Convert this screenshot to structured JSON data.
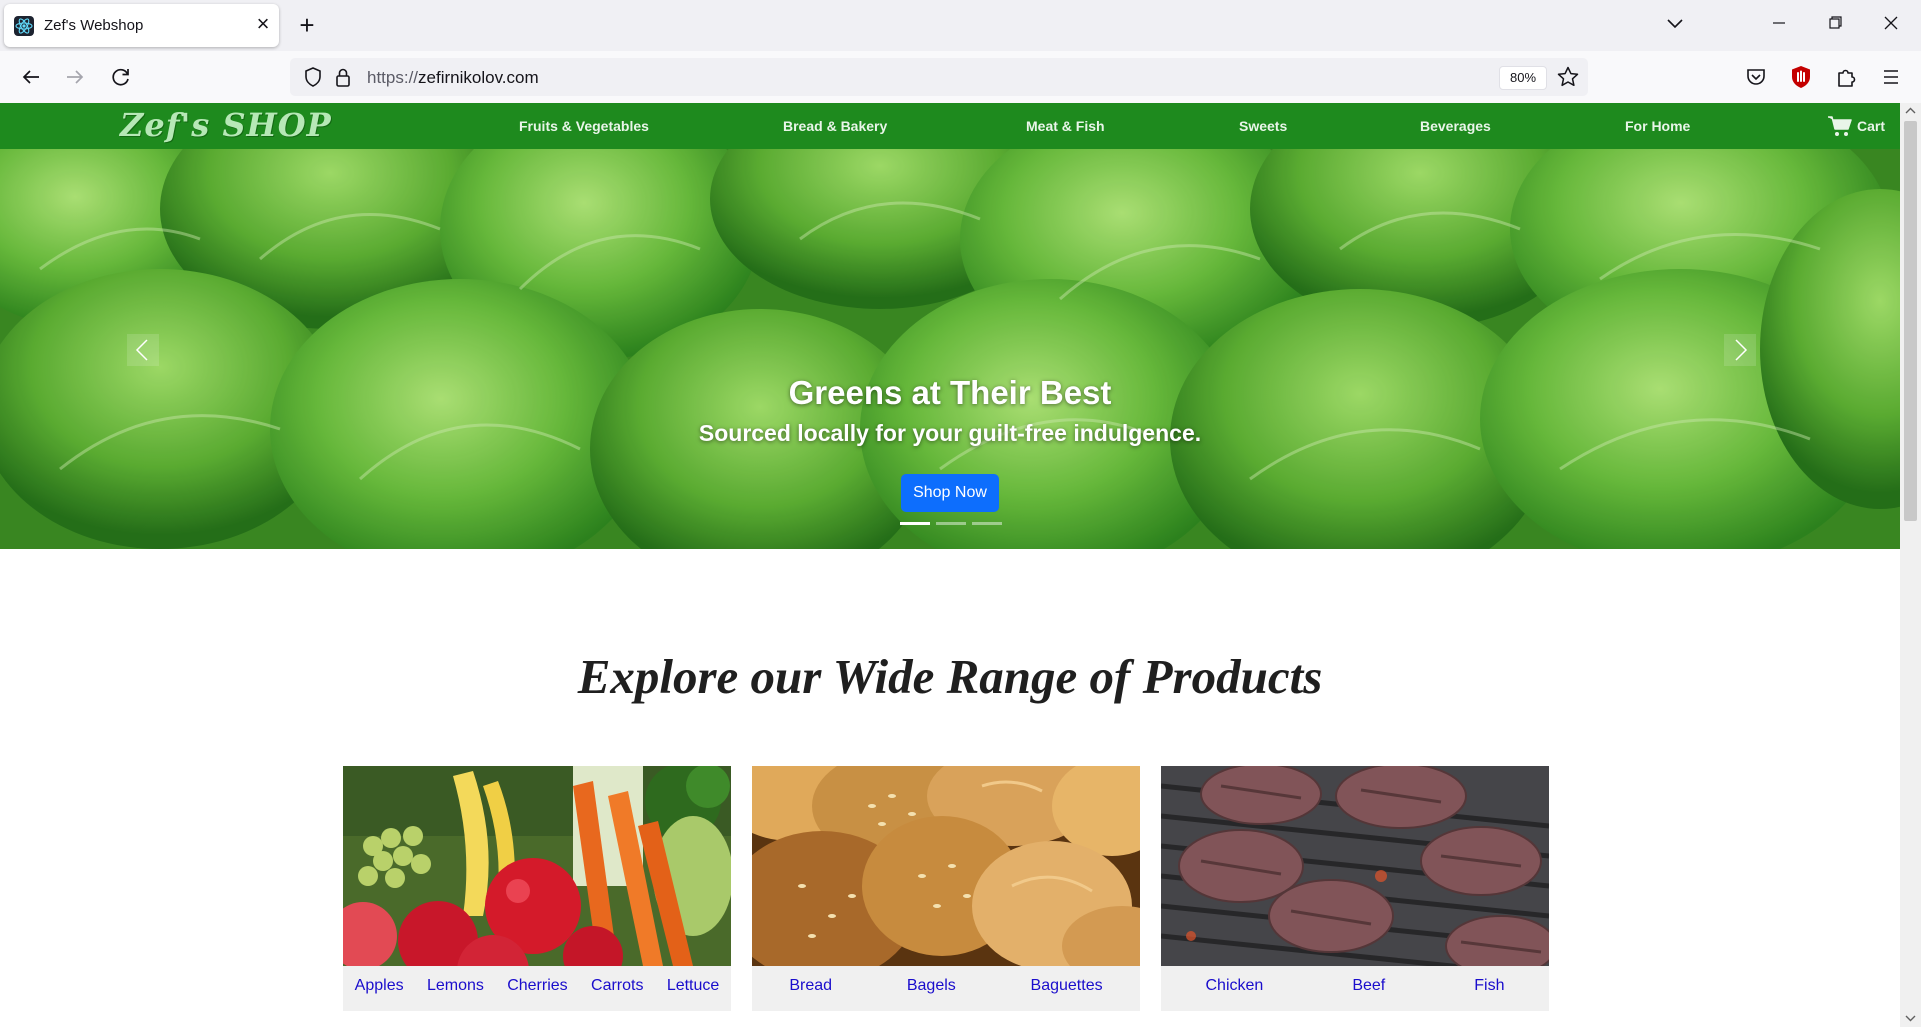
{
  "browser": {
    "tab_title": "Zef's Webshop",
    "url_protocol": "https://",
    "url_host": "zefirnikolov.com",
    "zoom": "80%"
  },
  "site": {
    "logo": "Zef's SHOP",
    "nav": [
      "Fruits & Vegetables",
      "Bread & Bakery",
      "Meat & Fish",
      "Sweets",
      "Beverages",
      "For Home"
    ],
    "cart_label": "Cart"
  },
  "hero": {
    "title": "Greens at Their Best",
    "subtitle": "Sourced locally for your guilt-free indulgence.",
    "button": "Shop Now",
    "slide_count": 3,
    "active_slide": 1
  },
  "section_title": "Explore our Wide Range of Products",
  "categories": [
    {
      "links": [
        "Apples",
        "Lemons",
        "Cherries",
        "Carrots",
        "Lettuce"
      ]
    },
    {
      "links": [
        "Bread",
        "Bagels",
        "Baguettes"
      ]
    },
    {
      "links": [
        "Chicken",
        "Beef",
        "Fish"
      ]
    }
  ],
  "colors": {
    "site_nav": "#1e8a1e",
    "primary_button": "#0d6efd",
    "link": "#1a0dcc"
  }
}
